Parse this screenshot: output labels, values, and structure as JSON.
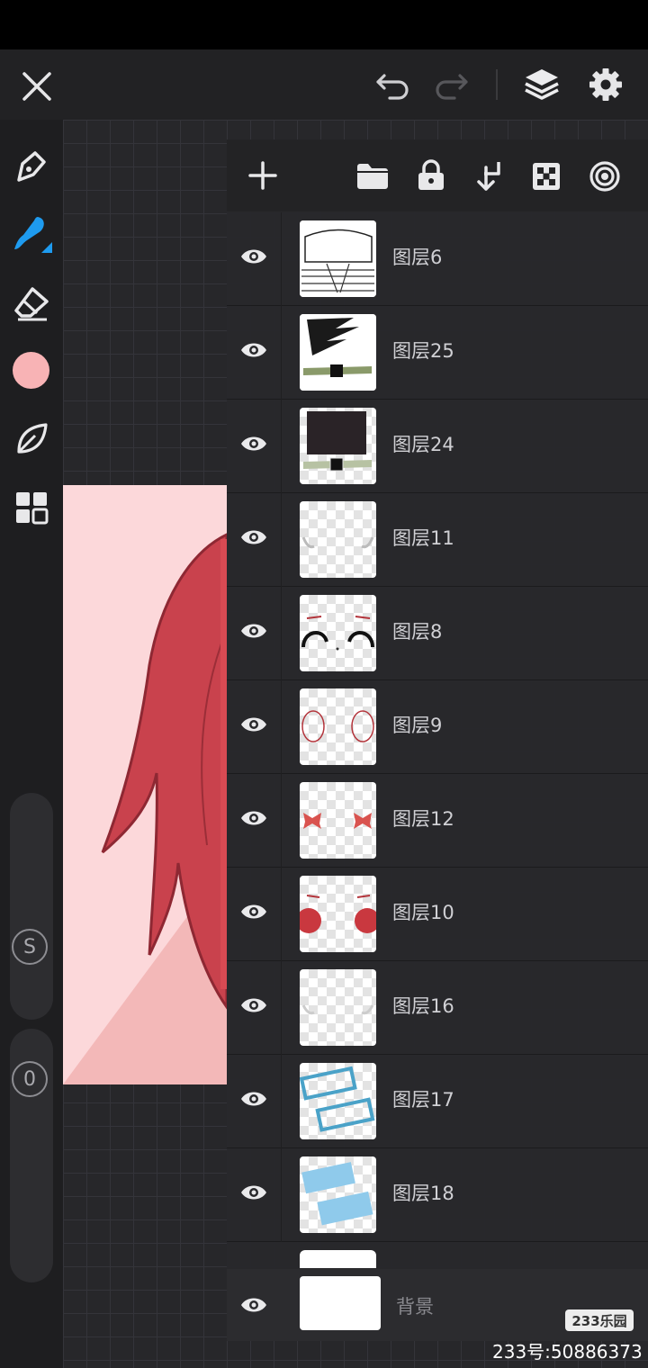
{
  "layers_panel": {
    "layers": [
      {
        "name": "图层6"
      },
      {
        "name": "图层25"
      },
      {
        "name": "图层24"
      },
      {
        "name": "图层11"
      },
      {
        "name": "图层8"
      },
      {
        "name": "图层9"
      },
      {
        "name": "图层12"
      },
      {
        "name": "图层10"
      },
      {
        "name": "图层16"
      },
      {
        "name": "图层17"
      },
      {
        "name": "图层18"
      }
    ],
    "background_layer": {
      "name": "背景"
    }
  },
  "left_toolbar": {
    "brush_color": "#f8b3b5",
    "slider_size_label": "S",
    "slider_opacity_label": "0"
  },
  "colors": {
    "accent": "#1e9bef",
    "panel": "#28282b"
  },
  "watermark": {
    "logo_text": "233乐园",
    "id_text": "233号:50886373"
  }
}
